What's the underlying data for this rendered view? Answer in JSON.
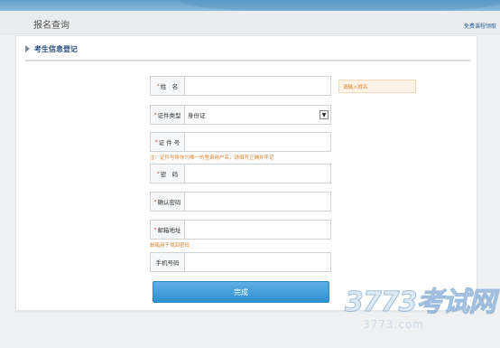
{
  "header": {
    "title": "报名查询",
    "right_link": "免费课程领取"
  },
  "section": {
    "title": "考生信息登记"
  },
  "form": {
    "name_label": "姓　名",
    "id_type_label": "证件类型",
    "id_type_value": "身份证",
    "id_number_label": "证 件 号",
    "id_hint": "注：证件号将作为唯一的登录用户名，请填写正确并牢记",
    "password_label": "密　码",
    "confirm_password_label": "确认密码",
    "email_label": "邮箱地址",
    "email_hint": "邮箱用于找回密码",
    "phone_label": "手机号码",
    "name_tip": "请输入姓名",
    "submit_label": "完成"
  },
  "watermark": {
    "big": "3773考试网",
    "small": "3773.com"
  },
  "colors": {
    "accent": "#2f8fd0",
    "hint": "#d9822b",
    "required": "#d9534f"
  }
}
